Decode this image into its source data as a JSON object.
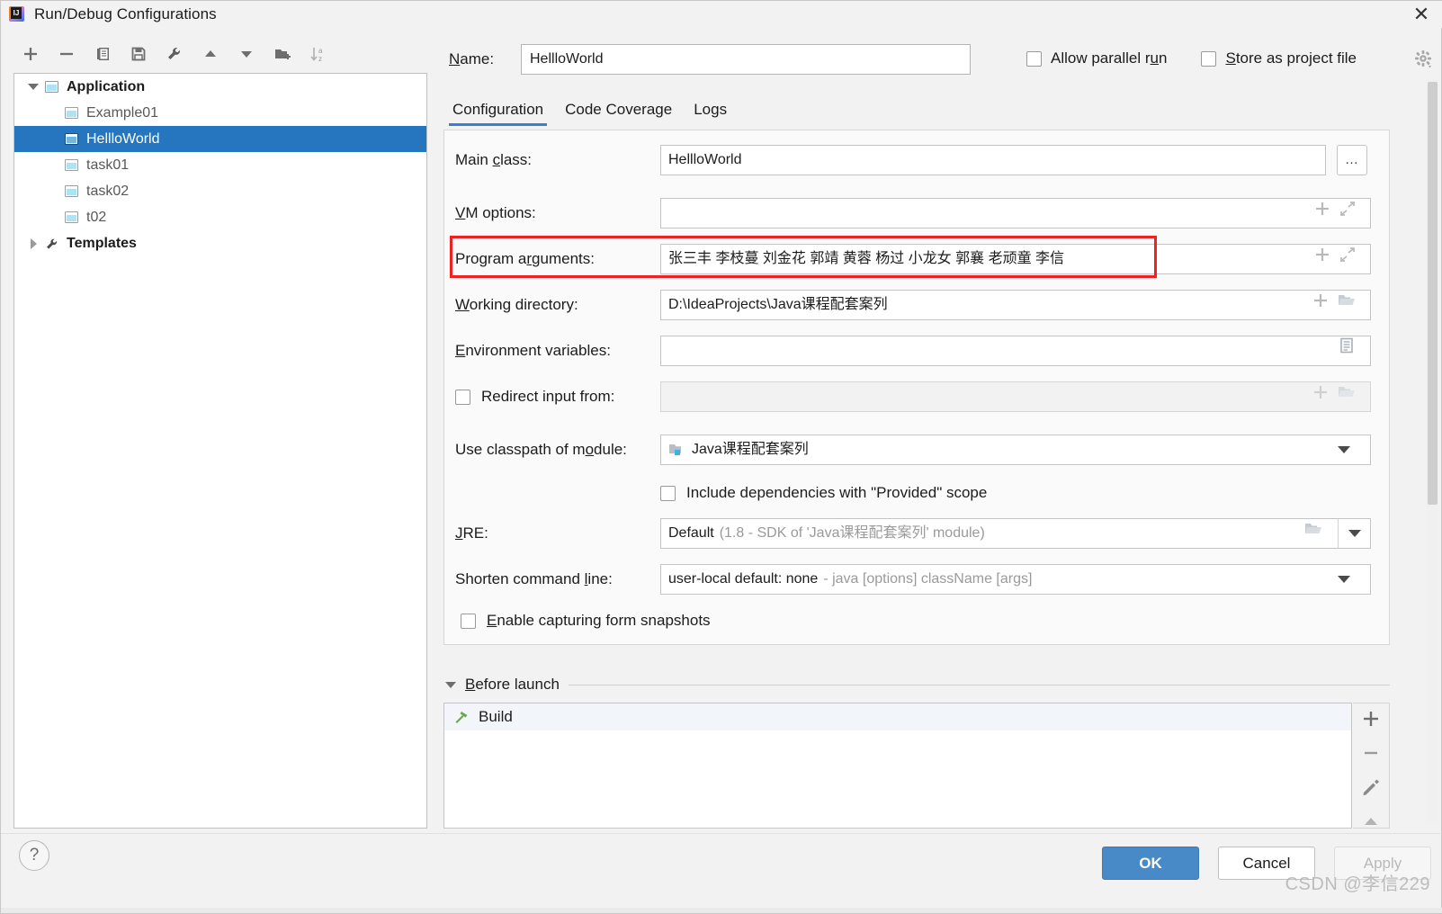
{
  "window": {
    "title": "Run/Debug Configurations",
    "close_label": "✕",
    "app_icon": "intellij-idea-icon",
    "logo_text": "IJ"
  },
  "toolbar": {
    "buttons": [
      {
        "name": "add-configuration-button",
        "icon": "plus-icon"
      },
      {
        "name": "remove-configuration-button",
        "icon": "minus-icon"
      },
      {
        "name": "copy-configuration-button",
        "icon": "copy-icon"
      },
      {
        "name": "save-configuration-button",
        "icon": "save-icon"
      },
      {
        "name": "edit-templates-button",
        "icon": "wrench-icon"
      },
      {
        "name": "move-up-button",
        "icon": "arrow-up-icon"
      },
      {
        "name": "move-down-button",
        "icon": "arrow-down-icon"
      },
      {
        "name": "new-folder-button",
        "icon": "folder-add-icon"
      },
      {
        "name": "sort-alphabetically-button",
        "icon": "sort-az-icon"
      }
    ]
  },
  "tree": {
    "items": [
      {
        "label": "Application",
        "level": 0,
        "expanded": true,
        "bold": true,
        "icon": "application-icon",
        "selected": false
      },
      {
        "label": "Example01",
        "level": 1,
        "bold": false,
        "icon": "application-icon",
        "selected": false
      },
      {
        "label": "HellloWorld",
        "level": 1,
        "bold": false,
        "icon": "application-icon",
        "selected": true
      },
      {
        "label": "task01",
        "level": 1,
        "bold": false,
        "icon": "application-icon",
        "selected": false
      },
      {
        "label": "task02",
        "level": 1,
        "bold": false,
        "icon": "application-icon",
        "selected": false
      },
      {
        "label": "t02",
        "level": 1,
        "bold": false,
        "icon": "application-icon",
        "selected": false
      },
      {
        "label": "Templates",
        "level": 0,
        "expanded": false,
        "bold": true,
        "icon": "wrench-icon",
        "selected": false
      }
    ]
  },
  "header": {
    "name_label": "Name:",
    "name_label_mnemonic": "N",
    "name_value": "HellloWorld",
    "allow_parallel_run": {
      "label": "Allow parallel run",
      "checked": false
    },
    "store_as_project_file": {
      "label": "Store as project file",
      "checked": false
    },
    "gear_icon": "gear-icon"
  },
  "tabs": [
    {
      "label": "Configuration",
      "active": true
    },
    {
      "label": "Code Coverage",
      "active": false
    },
    {
      "label": "Logs",
      "active": false
    }
  ],
  "form": {
    "main_class": {
      "label": "Main class:",
      "value": "HellloWorld",
      "browse_label": "…"
    },
    "vm_options": {
      "label": "VM options:",
      "value": ""
    },
    "program_arguments": {
      "label": "Program arguments:",
      "value": "张三丰 李枝蔓 刘金花 郭靖 黄蓉 杨过 小龙女 郭襄 老顽童 李信",
      "highlighted": true,
      "highlight_color": "#ee2222"
    },
    "working_directory": {
      "label": "Working directory:",
      "value": "D:\\IdeaProjects\\Java课程配套案列"
    },
    "environment_variables": {
      "label": "Environment variables:",
      "value": ""
    },
    "redirect_input": {
      "label": "Redirect input from:",
      "checked": false,
      "value": ""
    },
    "use_classpath_of_module": {
      "label": "Use classpath of module:",
      "value": "Java课程配套案列",
      "icon": "module-icon"
    },
    "include_provided_scope": {
      "label": "Include dependencies with \"Provided\" scope",
      "checked": false
    },
    "jre": {
      "label": "JRE:",
      "value": "Default",
      "hint": "(1.8 - SDK of 'Java课程配套案列' module)"
    },
    "shorten_command_line": {
      "label": "Shorten command line:",
      "value": "user-local default: none",
      "hint": "- java [options] className [args]"
    },
    "enable_capturing_form_snapshots": {
      "label": "Enable capturing form snapshots",
      "checked": false
    }
  },
  "before_launch": {
    "title": "Before launch",
    "expanded": true,
    "tasks": [
      {
        "label": "Build",
        "icon": "hammer-icon"
      }
    ],
    "side_buttons": [
      {
        "name": "add-task-button",
        "icon": "plus-icon"
      },
      {
        "name": "remove-task-button",
        "icon": "minus-icon"
      },
      {
        "name": "edit-task-button",
        "icon": "pencil-icon"
      },
      {
        "name": "move-task-up-button",
        "icon": "arrow-up-icon"
      }
    ]
  },
  "footer": {
    "help_label": "?",
    "ok_label": "OK",
    "cancel_label": "Cancel",
    "apply_label": "Apply",
    "apply_enabled": false
  },
  "watermark": "CSDN @李信229"
}
